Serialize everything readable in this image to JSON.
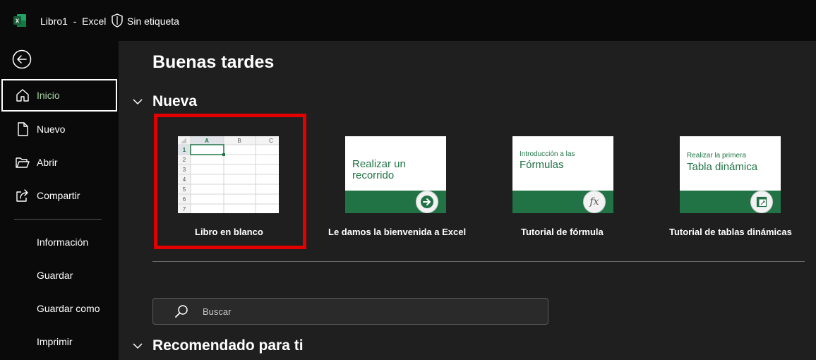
{
  "titlebar": {
    "app_icon": "excel-icon",
    "title": "Libro1  -  Excel",
    "sensitivity_icon": "shield-icon",
    "sensitivity_label": "Sin etiqueta"
  },
  "sidebar": {
    "back_icon": "back-arrow-icon",
    "items": [
      {
        "label": "Inicio",
        "icon": "home-icon",
        "active": true
      },
      {
        "label": "Nuevo",
        "icon": "new-document-icon"
      },
      {
        "label": "Abrir",
        "icon": "folder-open-icon"
      },
      {
        "label": "Compartir",
        "icon": "share-icon"
      }
    ],
    "text_items": [
      "Información",
      "Guardar",
      "Guardar como",
      "Imprimir"
    ]
  },
  "main": {
    "greeting": "Buenas tardes",
    "new_section": "Nueva",
    "templates": [
      {
        "label": "Libro en blanco",
        "kind": "blank-workbook",
        "selected": true
      },
      {
        "label": "Le damos la bienvenida a Excel",
        "kind": "tour",
        "thumb_text": "Realizar un recorrido",
        "icon": "arrow-right-icon"
      },
      {
        "label": "Tutorial de fórmula",
        "kind": "formula",
        "thumb_small": "Introducción a las",
        "thumb_big": "Fórmulas",
        "icon": "fx-icon"
      },
      {
        "label": "Tutorial de tablas dinámicas",
        "kind": "pivot",
        "thumb_small": "Realizar la primera",
        "thumb_big": "Tabla dinámica",
        "icon": "pivot-table-icon"
      }
    ],
    "blank_thumb": {
      "columns": [
        "A",
        "B",
        "C"
      ],
      "rows": [
        "1",
        "2",
        "3",
        "4",
        "5",
        "6",
        "7"
      ]
    },
    "search": {
      "placeholder": "Buscar",
      "icon": "search-icon"
    },
    "recommended_section": "Recomendado para ti"
  },
  "colors": {
    "excel_green": "#217346",
    "highlight_red": "#e30000",
    "active_text": "#a6d6a6"
  }
}
